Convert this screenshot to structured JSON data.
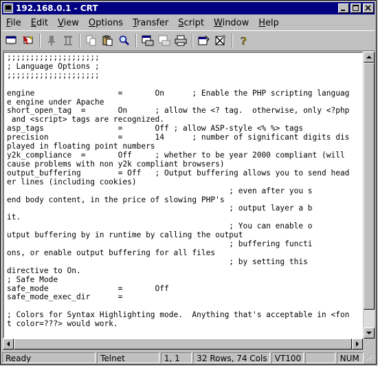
{
  "window": {
    "title": "192.168.0.1 - CRT",
    "min_label": "_",
    "max_label": "□",
    "close_label": "×"
  },
  "menu": [
    {
      "label": "File",
      "key": "F",
      "rest": "ile"
    },
    {
      "label": "Edit",
      "key": "E",
      "rest": "dit"
    },
    {
      "label": "View",
      "key": "V",
      "rest": "iew"
    },
    {
      "label": "Options",
      "key": "O",
      "rest": "ptions"
    },
    {
      "label": "Transfer",
      "key": "T",
      "rest": "ransfer"
    },
    {
      "label": "Script",
      "key": "S",
      "rest": "cript"
    },
    {
      "label": "Window",
      "key": "W",
      "rest": "indow"
    },
    {
      "label": "Help",
      "key": "H",
      "rest": "elp"
    }
  ],
  "toolbar": [
    "connect-icon",
    "quick-connect-icon",
    "connect-in-tab-icon",
    "disconnect-icon",
    "copy-icon",
    "paste-icon",
    "find-icon",
    "print-setup-icon",
    "print-screen-icon",
    "print-icon",
    "session-options-icon",
    "global-options-icon",
    "help-icon"
  ],
  "terminal": {
    "lines": [
      ";;;;;;;;;;;;;;;;;;;;",
      "; Language Options ;",
      ";;;;;;;;;;;;;;;;;;;;",
      "",
      "engine                  =       On      ; Enable the PHP scripting languag",
      "e engine under Apache",
      "short_open_tag  =       On      ; allow the <? tag.  otherwise, only <?php",
      " and <script> tags are recognized.",
      "asp_tags                =       Off ; allow ASP-style <% %> tags",
      "precision               =       14      ; number of significant digits dis",
      "played in floating point numbers",
      "y2k_compliance  =       Off     ; whether to be year 2000 compliant (will",
      "cause problems with non y2k compliant browsers)",
      "output_buffering        = Off   ; Output buffering allows you to send head",
      "er lines (including cookies)",
      "                                                ; even after you s",
      "end body content, in the price of slowing PHP's",
      "                                                ; output layer a b",
      "it.",
      "                                                ; You can enable o",
      "utput buffering by in runtime by calling the output",
      "                                                ; buffering functi",
      "ons, or enable output buffering for all files",
      "                                                ; by setting this",
      "directive to On.",
      "; Safe Mode",
      "safe_mode               =       Off",
      "safe_mode_exec_dir      =",
      "",
      "; Colors for Syntax Highlighting mode.  Anything that's acceptable in <fon",
      "t color=???> would work."
    ]
  },
  "status": {
    "ready": "Ready",
    "protocol": "Telnet",
    "cursor": "1,   1",
    "size": "32 Rows,  74 Cols",
    "emulation": "VT100",
    "blank": "",
    "numlock": "NUM"
  },
  "colors": {
    "title_bar": "#000080",
    "chrome": "#c0c0c0",
    "terminal_bg": "#ffffff",
    "terminal_fg": "#000000"
  }
}
